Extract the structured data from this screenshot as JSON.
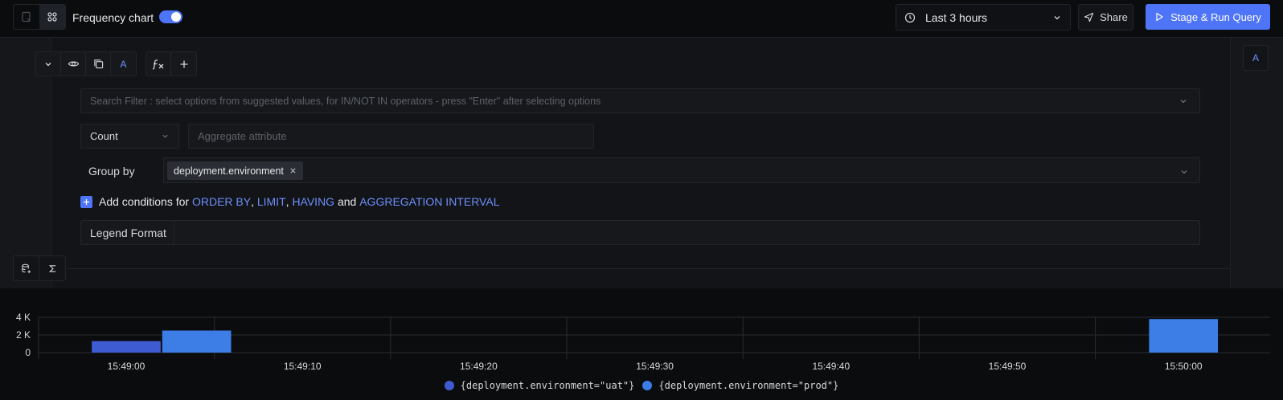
{
  "toolbar": {
    "frequency_label": "Frequency chart",
    "frequency_enabled": true,
    "time_range": "Last 3 hours",
    "share_label": "Share",
    "run_label": "Stage & Run Query"
  },
  "query": {
    "name": "A",
    "rail_label": "A",
    "search_placeholder": "Search Filter : select options from suggested values, for IN/NOT IN operators - press \"Enter\" after selecting options",
    "aggregate_operator": "Count",
    "aggregate_attribute_placeholder": "Aggregate attribute",
    "group_by_label": "Group by",
    "group_by_tags": [
      "deployment.environment"
    ],
    "add_conditions": {
      "prefix": "Add conditions for",
      "order_by": "ORDER BY",
      "comma1": ",",
      "limit": "LIMIT",
      "comma2": ",",
      "having": "HAVING",
      "and": "and",
      "interval": "AGGREGATION INTERVAL"
    },
    "legend_format_label": "Legend Format",
    "legend_format_value": ""
  },
  "colors": {
    "accent": "#4e74f8",
    "uat": "#3f5bd1",
    "prod": "#3c7de6"
  },
  "chart_data": {
    "type": "bar",
    "y_ticks": [
      "4 K",
      "2 K",
      "0"
    ],
    "ylim": [
      0,
      4000
    ],
    "x_ticks": [
      "15:49:00",
      "15:49:10",
      "15:49:20",
      "15:49:30",
      "15:49:40",
      "15:49:50",
      "15:50:00"
    ],
    "bars": [
      {
        "series": "{deployment.environment=\"uat\"}",
        "x_start": "15:48:58",
        "x_end": "15:49:02",
        "value": 1300
      },
      {
        "series": "{deployment.environment=\"prod\"}",
        "x_start": "15:49:02",
        "x_end": "15:49:06",
        "value": 2500
      },
      {
        "series": "{deployment.environment=\"prod\"}",
        "x_start": "15:49:58",
        "x_end": "15:50:02",
        "value": 3800
      }
    ],
    "series": [
      {
        "name": "{deployment.environment=\"uat\"}",
        "color": "#3f5bd1"
      },
      {
        "name": "{deployment.environment=\"prod\"}",
        "color": "#3c7de6"
      }
    ],
    "grid": true,
    "legend_position": "bottom"
  }
}
